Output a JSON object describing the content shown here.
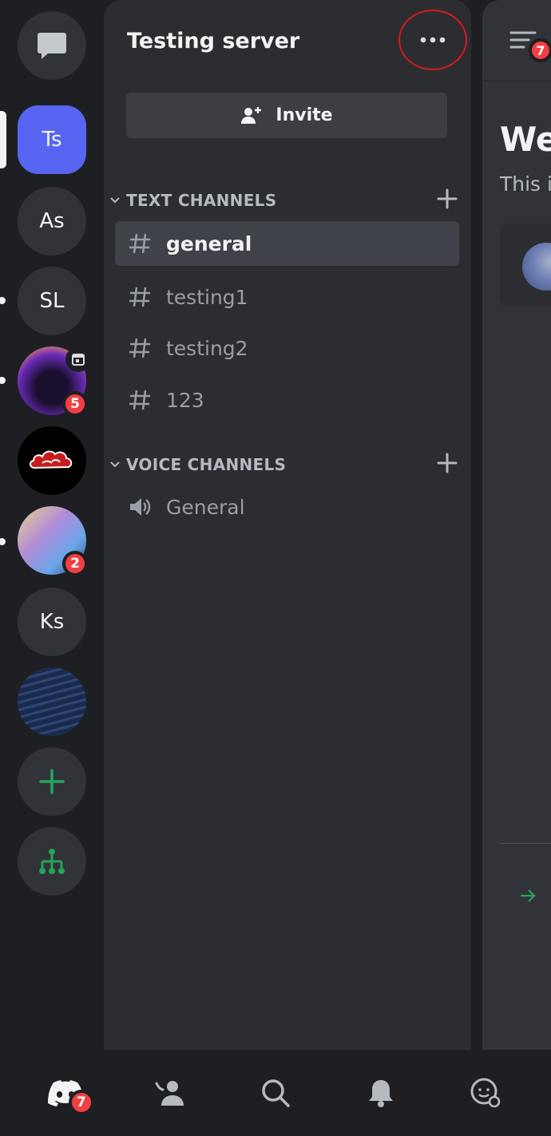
{
  "server": {
    "name": "Testing server",
    "invite_label": "Invite"
  },
  "rail": {
    "servers": [
      {
        "label": "Ts",
        "active": true
      },
      {
        "label": "As"
      },
      {
        "label": "SL"
      },
      {
        "label": "",
        "badge": "5",
        "has_event_icon": true
      },
      {
        "label": ""
      },
      {
        "label": "",
        "badge": "2"
      },
      {
        "label": "Ks"
      },
      {
        "label": ""
      }
    ],
    "add_server_icon": "plus-icon",
    "discover_icon": "hub-icon"
  },
  "categories": {
    "text": {
      "label": "TEXT CHANNELS"
    },
    "voice": {
      "label": "VOICE CHANNELS"
    }
  },
  "text_channels": [
    {
      "name": "general",
      "active": true
    },
    {
      "name": "testing1"
    },
    {
      "name": "testing2"
    },
    {
      "name": "123"
    }
  ],
  "voice_channels": [
    {
      "name": "General"
    }
  ],
  "main": {
    "welcome_fragment": "We",
    "subtitle_fragment": "This i",
    "member_list_badge": "7"
  },
  "tabbar": {
    "home_badge": "7"
  },
  "colors": {
    "brand": "#5865f2",
    "green": "#23a55a",
    "danger": "#f23f43",
    "highlight_circle": "#d71920"
  }
}
